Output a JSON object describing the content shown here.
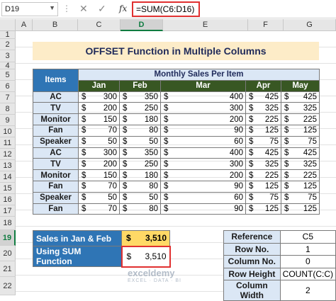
{
  "formula_bar": {
    "name_box": "D19",
    "formula": "=SUM(C6:D16)",
    "fx": "fx"
  },
  "columns": [
    "A",
    "B",
    "C",
    "D",
    "E",
    "F",
    "G"
  ],
  "rows": [
    "1",
    "2",
    "3",
    "4",
    "5",
    "6",
    "7",
    "8",
    "9",
    "10",
    "11",
    "12",
    "13",
    "14",
    "15",
    "16",
    "17",
    "18",
    "19",
    "20",
    "21",
    "22"
  ],
  "title": "OFFSET Function in Multiple Columns",
  "table": {
    "items_header": "Items",
    "group_header": "Monthly Sales Per Item",
    "months": [
      "Jan",
      "Feb",
      "Mar",
      "Apr",
      "May"
    ],
    "currency": "$",
    "rows": [
      {
        "item": "AC",
        "values": [
          "300",
          "350",
          "400",
          "425",
          "425"
        ]
      },
      {
        "item": "TV",
        "values": [
          "200",
          "250",
          "300",
          "325",
          "325"
        ]
      },
      {
        "item": "Monitor",
        "values": [
          "150",
          "180",
          "200",
          "225",
          "225"
        ]
      },
      {
        "item": "Fan",
        "values": [
          "70",
          "80",
          "90",
          "125",
          "125"
        ]
      },
      {
        "item": "Speaker",
        "values": [
          "50",
          "50",
          "60",
          "75",
          "75"
        ]
      },
      {
        "item": "AC",
        "values": [
          "300",
          "350",
          "400",
          "425",
          "425"
        ]
      },
      {
        "item": "TV",
        "values": [
          "200",
          "250",
          "300",
          "325",
          "325"
        ]
      },
      {
        "item": "Monitor",
        "values": [
          "150",
          "180",
          "200",
          "225",
          "225"
        ]
      },
      {
        "item": "Fan",
        "values": [
          "70",
          "80",
          "90",
          "125",
          "125"
        ]
      },
      {
        "item": "Speaker",
        "values": [
          "50",
          "50",
          "60",
          "75",
          "75"
        ]
      },
      {
        "item": "Fan",
        "values": [
          "70",
          "80",
          "90",
          "125",
          "125"
        ]
      }
    ]
  },
  "summary": [
    {
      "label": "Sales in Jan & Feb",
      "currency": "$",
      "value": "3,510"
    },
    {
      "label": "Using SUM Function",
      "currency": "$",
      "value": "3,510"
    }
  ],
  "params": [
    {
      "label": "Reference",
      "value": "C5"
    },
    {
      "label": "Row No.",
      "value": "1"
    },
    {
      "label": "Column No.",
      "value": "0"
    },
    {
      "label": "Row Height",
      "value": "COUNT(C:C)"
    },
    {
      "label": "Column Width",
      "value": "2"
    }
  ],
  "watermark": {
    "brand": "exceldemy",
    "tagline": "EXCEL · DATA · BI"
  },
  "colors": {
    "header_blue": "#2f75b5",
    "month_green": "#385723",
    "title_bg": "#fdecc8",
    "highlight": "#e03030",
    "summary_yellow": "#ffd966"
  }
}
